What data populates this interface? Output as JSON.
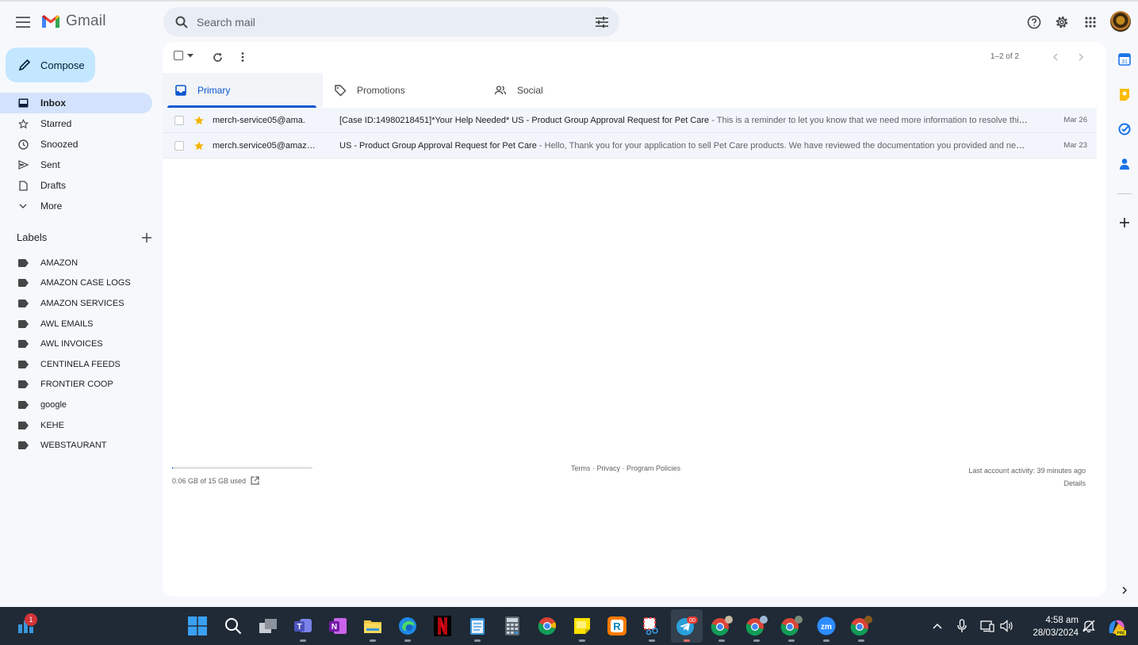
{
  "app": {
    "name": "Gmail"
  },
  "search": {
    "placeholder": "Search mail"
  },
  "compose": {
    "label": "Compose"
  },
  "nav": [
    {
      "label": "Inbox",
      "icon": "inbox-icon",
      "active": true
    },
    {
      "label": "Starred",
      "icon": "star-icon"
    },
    {
      "label": "Snoozed",
      "icon": "clock-icon"
    },
    {
      "label": "Sent",
      "icon": "send-icon"
    },
    {
      "label": "Drafts",
      "icon": "draft-icon"
    },
    {
      "label": "More",
      "icon": "chevron-down-icon"
    }
  ],
  "labels": {
    "title": "Labels",
    "items": [
      "AMAZON",
      "AMAZON CASE LOGS",
      "AMAZON SERVICES",
      "AWL EMAILS",
      "AWL INVOICES",
      "CENTINELA FEEDS",
      "FRONTIER COOP",
      "google",
      "KEHE",
      "WEBSTAURANT"
    ]
  },
  "toolbar": {
    "pager": "1–2 of 2"
  },
  "tabs": [
    {
      "label": "Primary",
      "icon": "inbox-icon"
    },
    {
      "label": "Promotions",
      "icon": "tag-icon"
    },
    {
      "label": "Social",
      "icon": "people-icon"
    }
  ],
  "emails": [
    {
      "sender": "merch-service05@ama.",
      "subject": "[Case ID:14980218451]*Your Help Needed* US - Product Group Approval Request for Pet Care",
      "snippet": " - This is a reminder to let you know that we need more information to resolve this case.",
      "date": "Mar 26",
      "starred": true
    },
    {
      "sender": "merch.service05@amaz…",
      "subject": "US - Product Group Approval Request for Pet Care",
      "snippet": " - Hello, Thank you for your application to sell Pet Care products. We have reviewed the documentation you provided and need more details.",
      "date": "Mar 23",
      "starred": true
    }
  ],
  "footer": {
    "storage": "0.06 GB of 15 GB used",
    "storage_fraction": 0.004,
    "links": "Terms · Privacy · Program Policies",
    "activity": "Last account activity: 39 minutes ago",
    "details": "Details"
  },
  "taskbar": {
    "notification_count": "1",
    "telegram_badge": "00",
    "time": "4:58 am",
    "date": "28/03/2024"
  },
  "colors": {
    "accent": "#0b57d0",
    "compose": "#c2e7ff",
    "active_nav": "#d3e3fd",
    "star": "#f4b400",
    "taskbar": "#1f2a36"
  }
}
